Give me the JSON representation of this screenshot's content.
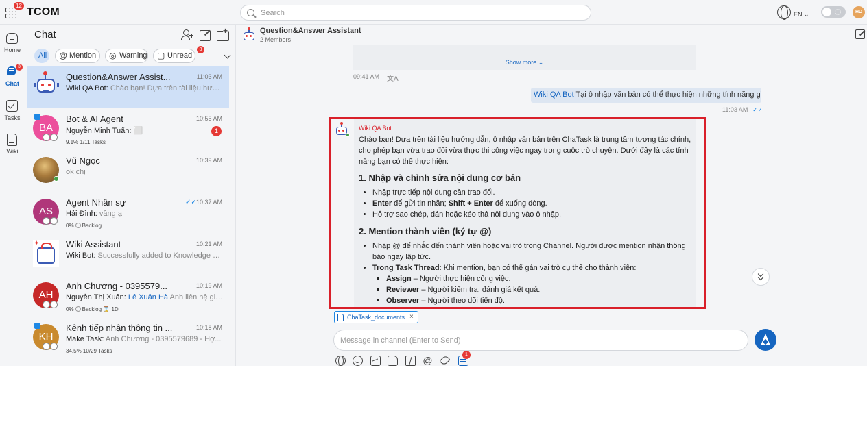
{
  "app": {
    "name": "TCOM",
    "apps_badge": "12"
  },
  "search": {
    "placeholder": "Search"
  },
  "top_right": {
    "language": "EN ⌄",
    "user_initials": "HD"
  },
  "nav": {
    "items": [
      {
        "label": "Home",
        "icon": "home-icon"
      },
      {
        "label": "Chat",
        "icon": "chat-icon",
        "badge": "3",
        "active": true
      },
      {
        "label": "Tasks",
        "icon": "tasks-icon"
      },
      {
        "label": "Wiki",
        "icon": "wiki-icon"
      }
    ]
  },
  "chatlist": {
    "title": "Chat",
    "filters": {
      "all": "All",
      "mention": "Mention",
      "warning": "Warning",
      "unread": "Unread",
      "unread_badge": "3"
    },
    "conversations": [
      {
        "name": "Question&Answer Assist...",
        "time": "11:03 AM",
        "sender": "Wiki QA Bot:",
        "preview": "Chào bạn! Dựa trên tài liệu hướn...",
        "selected": true,
        "avatar_type": "bot"
      },
      {
        "name": "Bot & AI Agent",
        "time": "10:55 AM",
        "sender": "Nguyễn Minh Tuấn:",
        "preview": "⬜",
        "meta": "9.1%  1/11 Tasks",
        "badge": "1",
        "initials": "BA",
        "avatar_color": "#ec4f9c"
      },
      {
        "name": "Vũ Ngọc",
        "time": "10:39 AM",
        "sender": "",
        "preview": "ok chị",
        "initials": "",
        "avatar_color": "#8a6b3f"
      },
      {
        "name": "Agent Nhân sự",
        "time": "10:37 AM",
        "sender": "Hải Đình:",
        "preview": "vâng ạ",
        "meta_pct": "0%",
        "meta_status": "Backlog",
        "initials": "AS",
        "avatar_color": "#b0367a"
      },
      {
        "name": "Wiki Assistant",
        "time": "10:21 AM",
        "sender": "Wiki Bot:",
        "preview": "Successfully added to Knowledge B...",
        "avatar_type": "wiki"
      },
      {
        "name": "Anh Chương - 0395579...",
        "time": "10:19 AM",
        "sender": "Nguyễn Thị Xuân:",
        "mention": "Lê Xuân Hà",
        "preview": "Anh liên hệ giú...",
        "meta_pct": "0%",
        "meta_status": "Backlog",
        "meta_due": "1D",
        "initials": "AH",
        "avatar_color": "#c62828"
      },
      {
        "name": "Kênh tiếp nhận thông tin ...",
        "time": "10:18 AM",
        "sender": "Make Task:",
        "preview": "Anh Chương - 0395579689 - Hợ...",
        "meta": "34.5%  10/29 Tasks",
        "initials": "KH",
        "avatar_color": "#c98a2e"
      }
    ]
  },
  "channel": {
    "title": "Question&Answer Assistant",
    "members": "2 Members",
    "show_more": "Show more ⌄",
    "prev_time": "09:41 AM",
    "translate_glyph": "文A",
    "out_msg": {
      "mention": "Wiki QA Bot",
      "text": " Tại ô nhập văn bản có thể thực hiện những tính năng gì nhỉ",
      "time": "11:03 AM",
      "read_glyph": "✓✓"
    },
    "bot_msg": {
      "sender": "Wiki QA Bot",
      "intro": "Chào bạn! Dựa trên tài liệu hướng dẫn, ô nhập văn bản trên ChaTask là trung tâm tương tác chính, cho phép bạn vừa trao đổi vừa thực thi công việc ngay trong cuộc trò chuyện. Dưới đây là các tính năng bạn có thể thực hiện:",
      "h1": "1. Nhập và chỉnh sửa nội dung cơ bản",
      "s1_1": "Nhập trực tiếp nội dung cần trao đổi.",
      "s1_2_b1": "Enter",
      "s1_2_t1": " để gửi tin nhắn; ",
      "s1_2_b2": "Shift + Enter",
      "s1_2_t2": " để xuống dòng.",
      "s1_3": "Hỗ trợ sao chép, dán hoặc kéo thả nội dung vào ô nhập.",
      "h2": "2. Mention thành viên (ký tự @)",
      "s2_1": "Nhập @ để nhắc đến thành viên hoặc vai trò trong Channel. Người được mention nhận thông báo ngay lập tức.",
      "s2_2_b": "Trong Task Thread",
      "s2_2_t": ": Khi mention, bạn có thể gán vai trò cụ thể cho thành viên:",
      "r1_b": "Assign",
      "r1_t": " – Người thực hiện công việc.",
      "r2_b": "Reviewer",
      "r2_t": " – Người kiểm tra, đánh giá kết quả.",
      "r3_b": "Observer",
      "r3_t": " – Người theo dõi tiến độ."
    },
    "attachment": {
      "name": "ChaTask_documents",
      "close": "×"
    },
    "composer": {
      "placeholder": "Message in channel (Enter to Send)",
      "value": ""
    },
    "toolbar_badge": "1"
  }
}
